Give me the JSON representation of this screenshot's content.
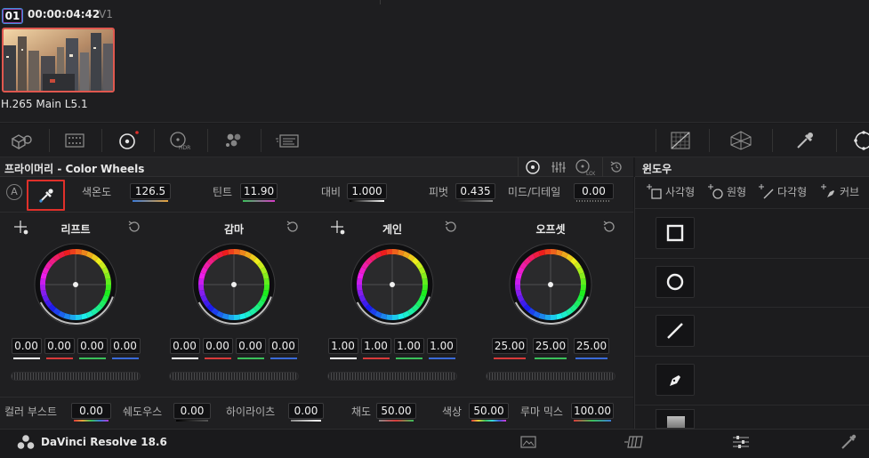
{
  "clip": {
    "badge": "01",
    "timecode": "00:00:04:42",
    "track": "V1",
    "codec": "H.265 Main L5.1"
  },
  "toolbar": {
    "left_icons": [
      "3d-cube-icon",
      "grid-dots-icon",
      "color-wheel-target-icon",
      "hdr-wheel-icon",
      "rgb-mixer-icon",
      "motion-effects-icon"
    ],
    "right_icons": [
      "curves-icon",
      "qualifier-icon",
      "eyedropper-window-icon",
      "tracker-icon"
    ]
  },
  "panel": {
    "title": "프라이머리 - Color Wheels",
    "auto_badge": "A",
    "temperature": {
      "label": "색온도",
      "value": "126.5"
    },
    "tint": {
      "label": "틴트",
      "value": "11.90"
    },
    "contrast": {
      "label": "대비",
      "value": "1.000"
    },
    "pivot": {
      "label": "피벗",
      "value": "0.435"
    },
    "mid_detail": {
      "label": "미드/디테일",
      "value": "0.00"
    }
  },
  "wheels": [
    {
      "label": "리프트",
      "values": [
        "0.00",
        "0.00",
        "0.00",
        "0.00"
      ]
    },
    {
      "label": "감마",
      "values": [
        "0.00",
        "0.00",
        "0.00",
        "0.00"
      ]
    },
    {
      "label": "게인",
      "values": [
        "1.00",
        "1.00",
        "1.00",
        "1.00"
      ]
    },
    {
      "label": "오프셋",
      "values": [
        "25.00",
        "25.00",
        "25.00"
      ]
    }
  ],
  "bottom_params": {
    "color_boost": {
      "label": "컬러 부스트",
      "value": "0.00"
    },
    "shadows": {
      "label": "쉐도우스",
      "value": "0.00"
    },
    "highlights": {
      "label": "하이라이츠",
      "value": "0.00"
    },
    "saturation": {
      "label": "채도",
      "value": "50.00"
    },
    "hue": {
      "label": "색상",
      "value": "50.00"
    },
    "luma_mix": {
      "label": "루마 믹스",
      "value": "100.00"
    }
  },
  "window_panel": {
    "title": "윈도우",
    "tools": [
      "사각형",
      "원형",
      "다각형",
      "커브"
    ]
  },
  "app": {
    "name": "DaVinci Resolve 18.6"
  },
  "colors": {
    "accent_red": "#e0302a",
    "accent_blue": "#3c8fd8",
    "panel_bg": "#1f1f21"
  }
}
